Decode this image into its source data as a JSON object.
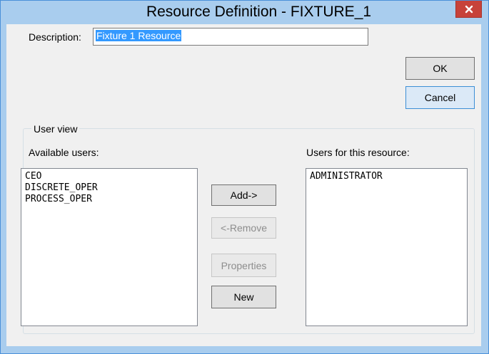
{
  "window": {
    "title": "Resource Definition - FIXTURE_1",
    "close_glyph": "x"
  },
  "description": {
    "label": "Description:",
    "value": "Fixture 1 Resource"
  },
  "buttons": {
    "ok": "OK",
    "cancel": "Cancel",
    "add": "Add->",
    "remove": "<-Remove",
    "properties": "Properties",
    "new": "New"
  },
  "user_view": {
    "legend": "User view",
    "available_label": "Available users:",
    "assigned_label": "Users for this resource:",
    "available_users": [
      "CEO",
      "DISCRETE_OPER",
      "PROCESS_OPER"
    ],
    "assigned_users": [
      "ADMINISTRATOR"
    ]
  },
  "colors": {
    "title_bar": "#a9cdee",
    "close_button": "#c7423a",
    "selection": "#3399ff"
  }
}
